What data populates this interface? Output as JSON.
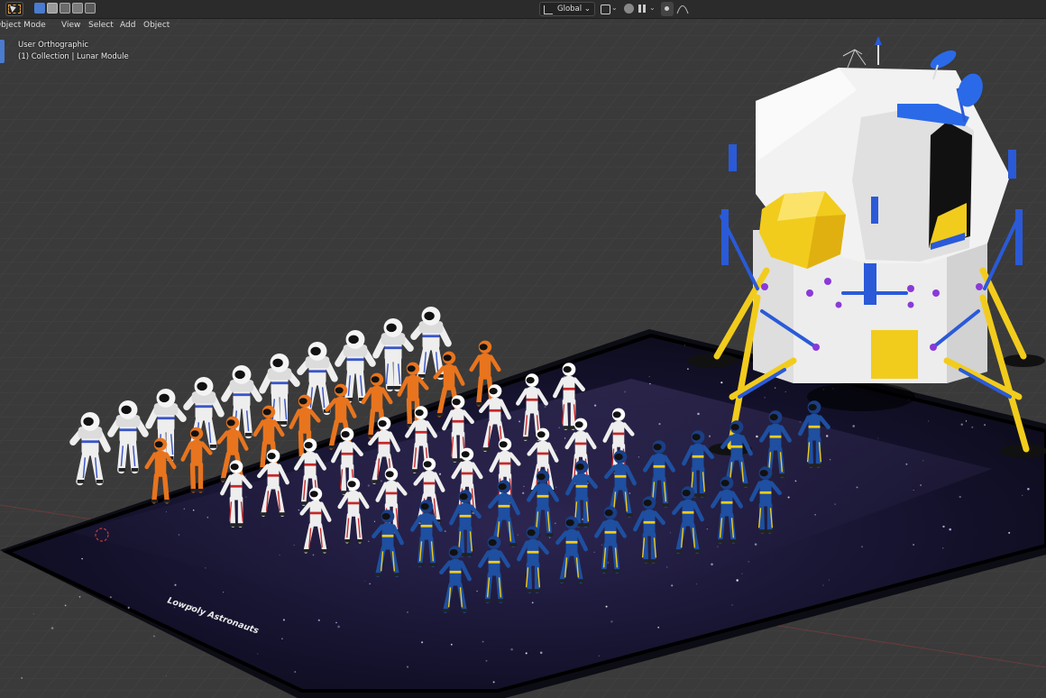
{
  "header": {
    "menus": [
      "Object Mode",
      "View",
      "Select",
      "Add",
      "Object"
    ],
    "transform_orientation": "Global",
    "chevron": "⌄"
  },
  "viewport": {
    "view_label": "User Orthographic",
    "collection_label": "(1) Collection | Lunar Module",
    "plane_caption": "Lowpoly Astronauts"
  },
  "colors": {
    "grid_bg": "#3a3a3a",
    "accent_blue": "#4a7bd0",
    "suit_white": "#eeeeee",
    "suit_orange": "#e8741e",
    "suit_red_stripe": "#c62828",
    "suit_blue": "#1e4fa0",
    "module_gold": "#f2cc1c",
    "module_white": "#f0f0f0"
  },
  "icons": [
    "select-box-icon",
    "mode-new-icon",
    "mode-extend-icon",
    "mode-subtract-icon",
    "mode-invert-icon",
    "mode-intersect-icon",
    "orientation-icon",
    "pivot-icon",
    "snap-icon",
    "proportional-icon",
    "falloff-icon"
  ]
}
